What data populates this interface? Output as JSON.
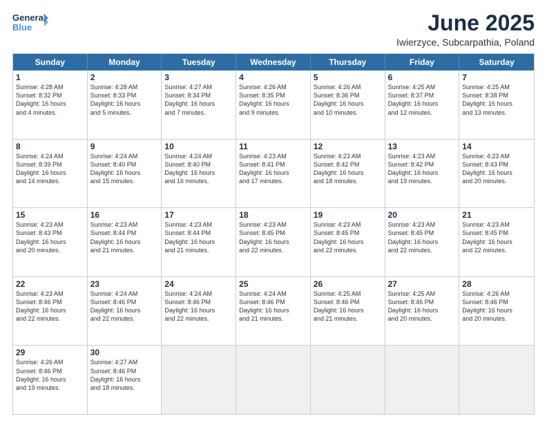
{
  "logo": {
    "line1": "General",
    "line2": "Blue"
  },
  "title": "June 2025",
  "subtitle": "Iwierzyce, Subcarpathia, Poland",
  "header_days": [
    "Sunday",
    "Monday",
    "Tuesday",
    "Wednesday",
    "Thursday",
    "Friday",
    "Saturday"
  ],
  "weeks": [
    [
      {
        "day": "1",
        "lines": [
          "Sunrise: 4:28 AM",
          "Sunset: 8:32 PM",
          "Daylight: 16 hours",
          "and 4 minutes."
        ]
      },
      {
        "day": "2",
        "lines": [
          "Sunrise: 4:28 AM",
          "Sunset: 8:33 PM",
          "Daylight: 16 hours",
          "and 5 minutes."
        ]
      },
      {
        "day": "3",
        "lines": [
          "Sunrise: 4:27 AM",
          "Sunset: 8:34 PM",
          "Daylight: 16 hours",
          "and 7 minutes."
        ]
      },
      {
        "day": "4",
        "lines": [
          "Sunrise: 4:26 AM",
          "Sunset: 8:35 PM",
          "Daylight: 16 hours",
          "and 9 minutes."
        ]
      },
      {
        "day": "5",
        "lines": [
          "Sunrise: 4:26 AM",
          "Sunset: 8:36 PM",
          "Daylight: 16 hours",
          "and 10 minutes."
        ]
      },
      {
        "day": "6",
        "lines": [
          "Sunrise: 4:25 AM",
          "Sunset: 8:37 PM",
          "Daylight: 16 hours",
          "and 12 minutes."
        ]
      },
      {
        "day": "7",
        "lines": [
          "Sunrise: 4:25 AM",
          "Sunset: 8:38 PM",
          "Daylight: 16 hours",
          "and 13 minutes."
        ]
      }
    ],
    [
      {
        "day": "8",
        "lines": [
          "Sunrise: 4:24 AM",
          "Sunset: 8:39 PM",
          "Daylight: 16 hours",
          "and 14 minutes."
        ]
      },
      {
        "day": "9",
        "lines": [
          "Sunrise: 4:24 AM",
          "Sunset: 8:40 PM",
          "Daylight: 16 hours",
          "and 15 minutes."
        ]
      },
      {
        "day": "10",
        "lines": [
          "Sunrise: 4:24 AM",
          "Sunset: 8:40 PM",
          "Daylight: 16 hours",
          "and 16 minutes."
        ]
      },
      {
        "day": "11",
        "lines": [
          "Sunrise: 4:23 AM",
          "Sunset: 8:41 PM",
          "Daylight: 16 hours",
          "and 17 minutes."
        ]
      },
      {
        "day": "12",
        "lines": [
          "Sunrise: 4:23 AM",
          "Sunset: 8:42 PM",
          "Daylight: 16 hours",
          "and 18 minutes."
        ]
      },
      {
        "day": "13",
        "lines": [
          "Sunrise: 4:23 AM",
          "Sunset: 8:42 PM",
          "Daylight: 16 hours",
          "and 19 minutes."
        ]
      },
      {
        "day": "14",
        "lines": [
          "Sunrise: 4:23 AM",
          "Sunset: 8:43 PM",
          "Daylight: 16 hours",
          "and 20 minutes."
        ]
      }
    ],
    [
      {
        "day": "15",
        "lines": [
          "Sunrise: 4:23 AM",
          "Sunset: 8:43 PM",
          "Daylight: 16 hours",
          "and 20 minutes."
        ]
      },
      {
        "day": "16",
        "lines": [
          "Sunrise: 4:23 AM",
          "Sunset: 8:44 PM",
          "Daylight: 16 hours",
          "and 21 minutes."
        ]
      },
      {
        "day": "17",
        "lines": [
          "Sunrise: 4:23 AM",
          "Sunset: 8:44 PM",
          "Daylight: 16 hours",
          "and 21 minutes."
        ]
      },
      {
        "day": "18",
        "lines": [
          "Sunrise: 4:23 AM",
          "Sunset: 8:45 PM",
          "Daylight: 16 hours",
          "and 22 minutes."
        ]
      },
      {
        "day": "19",
        "lines": [
          "Sunrise: 4:23 AM",
          "Sunset: 8:45 PM",
          "Daylight: 16 hours",
          "and 22 minutes."
        ]
      },
      {
        "day": "20",
        "lines": [
          "Sunrise: 4:23 AM",
          "Sunset: 8:45 PM",
          "Daylight: 16 hours",
          "and 22 minutes."
        ]
      },
      {
        "day": "21",
        "lines": [
          "Sunrise: 4:23 AM",
          "Sunset: 8:45 PM",
          "Daylight: 16 hours",
          "and 22 minutes."
        ]
      }
    ],
    [
      {
        "day": "22",
        "lines": [
          "Sunrise: 4:23 AM",
          "Sunset: 8:46 PM",
          "Daylight: 16 hours",
          "and 22 minutes."
        ]
      },
      {
        "day": "23",
        "lines": [
          "Sunrise: 4:24 AM",
          "Sunset: 8:46 PM",
          "Daylight: 16 hours",
          "and 22 minutes."
        ]
      },
      {
        "day": "24",
        "lines": [
          "Sunrise: 4:24 AM",
          "Sunset: 8:46 PM",
          "Daylight: 16 hours",
          "and 22 minutes."
        ]
      },
      {
        "day": "25",
        "lines": [
          "Sunrise: 4:24 AM",
          "Sunset: 8:46 PM",
          "Daylight: 16 hours",
          "and 21 minutes."
        ]
      },
      {
        "day": "26",
        "lines": [
          "Sunrise: 4:25 AM",
          "Sunset: 8:46 PM",
          "Daylight: 16 hours",
          "and 21 minutes."
        ]
      },
      {
        "day": "27",
        "lines": [
          "Sunrise: 4:25 AM",
          "Sunset: 8:46 PM",
          "Daylight: 16 hours",
          "and 20 minutes."
        ]
      },
      {
        "day": "28",
        "lines": [
          "Sunrise: 4:26 AM",
          "Sunset: 8:46 PM",
          "Daylight: 16 hours",
          "and 20 minutes."
        ]
      }
    ],
    [
      {
        "day": "29",
        "lines": [
          "Sunrise: 4:26 AM",
          "Sunset: 8:46 PM",
          "Daylight: 16 hours",
          "and 19 minutes."
        ]
      },
      {
        "day": "30",
        "lines": [
          "Sunrise: 4:27 AM",
          "Sunset: 8:46 PM",
          "Daylight: 16 hours",
          "and 18 minutes."
        ]
      },
      {
        "day": "",
        "lines": []
      },
      {
        "day": "",
        "lines": []
      },
      {
        "day": "",
        "lines": []
      },
      {
        "day": "",
        "lines": []
      },
      {
        "day": "",
        "lines": []
      }
    ]
  ]
}
